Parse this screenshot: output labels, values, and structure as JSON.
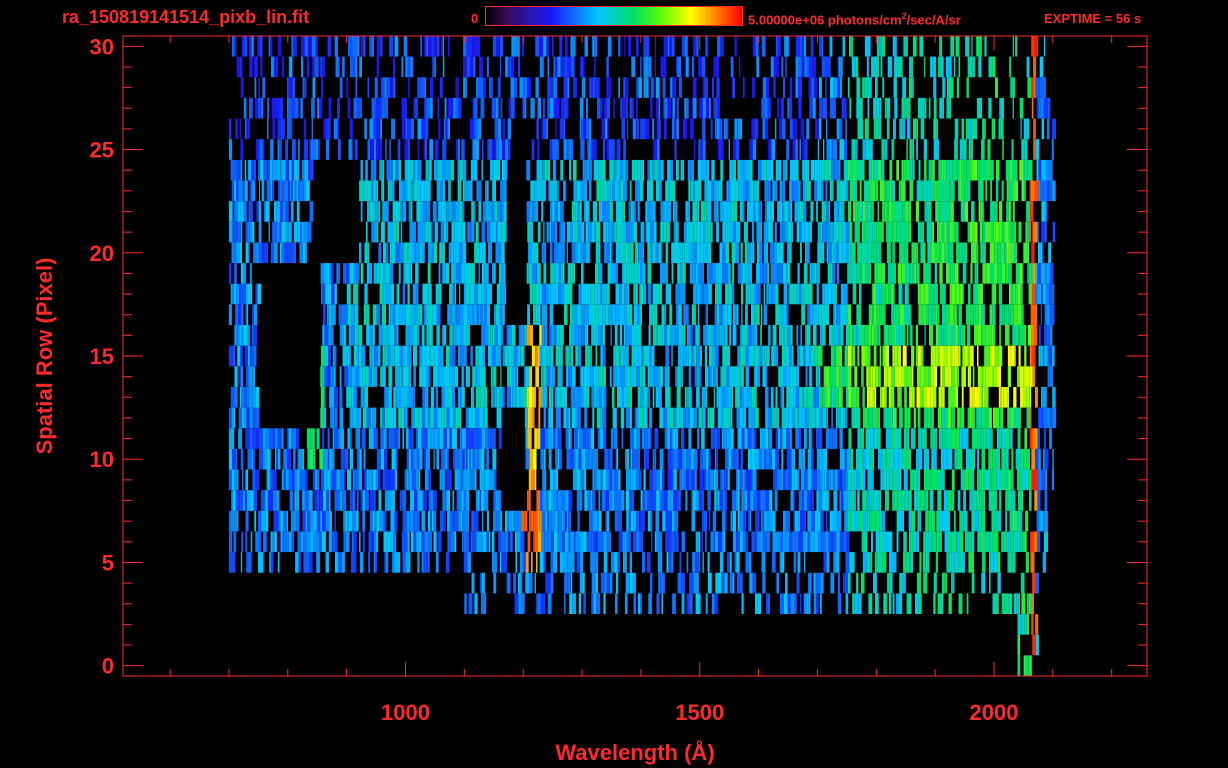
{
  "header": {
    "filename": "ra_150819141514_pixb_lin.fit",
    "colorbar_min": "0",
    "colorbar_max_prefix": "5.00000e+06 photons/cm",
    "colorbar_max_sup": "2",
    "colorbar_max_suffix": "/sec/A/sr",
    "exptime": "EXPTIME = 56 s"
  },
  "colors": {
    "axis": "#ff2a2a",
    "background": "#000000"
  },
  "chart_data": {
    "type": "heatmap",
    "title": "",
    "xlabel": "Wavelength (Å)",
    "ylabel": "Spatial Row (Pixel)",
    "xlim": [
      520,
      2260
    ],
    "ylim": [
      -0.5,
      30.5
    ],
    "x_ticks": [
      1000,
      1500,
      2000
    ],
    "x_tick_labels": [
      "1000",
      "1500",
      "2000"
    ],
    "y_ticks": [
      0,
      5,
      10,
      15,
      20,
      25,
      30
    ],
    "y_tick_labels": [
      "0",
      "5",
      "10",
      "15",
      "20",
      "25",
      "30"
    ],
    "colorbar": {
      "min": 0,
      "max": 5000000,
      "units": "photons/cm^2/sec/A/sr"
    },
    "data_x_range": [
      700,
      2100
    ],
    "features": [
      {
        "name": "Lyman-alpha",
        "wavelength": 1216,
        "rows": [
          5,
          16
        ],
        "peak_rows": [
          6,
          8
        ],
        "relative_intensity": 0.95
      },
      {
        "name": "bright-continuum-band",
        "wavelength_range": [
          1750,
          2060
        ],
        "rows": [
          13,
          15
        ],
        "relative_intensity": 0.72
      },
      {
        "name": "short-wavelength-feature",
        "wavelength": 840,
        "rows": [
          10,
          16
        ],
        "relative_intensity": 0.6
      },
      {
        "name": "red-edge",
        "wavelength": 2065,
        "rows": [
          0,
          27
        ],
        "relative_intensity": 0.9
      },
      {
        "name": "dark-gap",
        "wavelength_range": [
          1160,
          1200
        ],
        "rows": [
          8,
          12
        ],
        "relative_intensity": 0.0
      },
      {
        "name": "dark-gap",
        "wavelength_range": [
          1170,
          1205
        ],
        "rows": [
          17,
          24
        ],
        "relative_intensity": 0.0
      },
      {
        "name": "dark-gap",
        "wavelength_range": [
          750,
          855
        ],
        "rows": [
          12,
          19
        ],
        "relative_intensity": 0.0
      },
      {
        "name": "dark-gap",
        "wavelength_range": [
          840,
          920
        ],
        "rows": [
          20,
          24
        ],
        "relative_intensity": 0.0
      }
    ]
  }
}
